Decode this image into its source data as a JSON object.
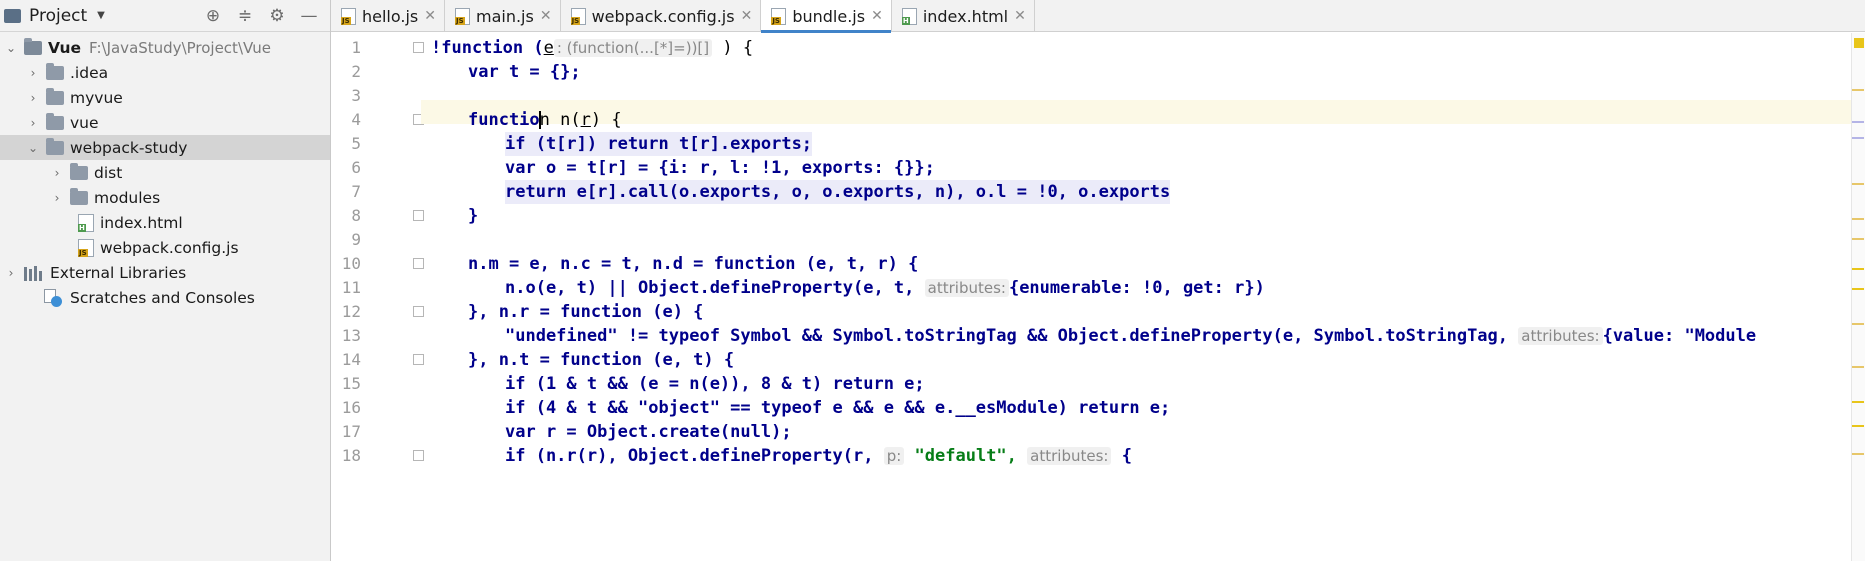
{
  "sidebar": {
    "title": "Project",
    "tree": [
      {
        "label": "Vue",
        "path": "F:\\JavaStudy\\Project\\Vue"
      },
      {
        "label": ".idea"
      },
      {
        "label": "myvue"
      },
      {
        "label": "vue"
      },
      {
        "label": "webpack-study"
      },
      {
        "label": "dist"
      },
      {
        "label": "modules"
      },
      {
        "label": "index.html"
      },
      {
        "label": "webpack.config.js"
      },
      {
        "label": "External Libraries"
      },
      {
        "label": "Scratches and Consoles"
      }
    ]
  },
  "tabs": [
    {
      "label": "hello.js"
    },
    {
      "label": "main.js"
    },
    {
      "label": "webpack.config.js"
    },
    {
      "label": "bundle.js"
    },
    {
      "label": "index.html"
    }
  ],
  "editor": {
    "line_numbers": [
      "1",
      "2",
      "3",
      "4",
      "5",
      "6",
      "7",
      "8",
      "9",
      "10",
      "11",
      "12",
      "13",
      "14",
      "15",
      "16",
      "17",
      "18"
    ],
    "hints": {
      "l1": ": (function(...[*]=))[]",
      "attributes": "attributes:",
      "p": "p:"
    },
    "code": {
      "l1_a": "!function (",
      "l1_e": "e",
      "l1_b": " ) {",
      "l2": "var t = {};",
      "l4_a": "functio",
      "l4_b": "n n(",
      "l4_r": "r",
      "l4_c": ") {",
      "l5": "if (t[r]) return t[r].exports;",
      "l6": "var o = t[r] = {i: r, l: !1, exports: {}};",
      "l7": "return e[r].call(o.exports, o, o.exports, n), o.l = !0, o.exports",
      "l8": "}",
      "l10": "n.m = e, n.c = t, n.d = function (e, t, r) {",
      "l11_a": "n.o(e, t) || Object.defineProperty(e, t,",
      "l11_b": "{enumerable: !0, get: r})",
      "l12": "}, n.r = function (e) {",
      "l13_a": "\"undefined\" != typeof Symbol && Symbol.toStringTag && Object.defineProperty(e, Symbol.toStringTag,",
      "l13_b": "{value: \"Module",
      "l14": "}, n.t = function (e, t) {",
      "l15": "if (1 & t && (e = n(e)), 8 & t) return e;",
      "l16": "if (4 & t && \"object\" == typeof e && e && e.__esModule) return e;",
      "l17": "var r = Object.create(null);",
      "l18_a": "if (n.r(r), Object.defineProperty(r,",
      "l18_b": "\"default\",",
      "l18_c": "{"
    }
  }
}
